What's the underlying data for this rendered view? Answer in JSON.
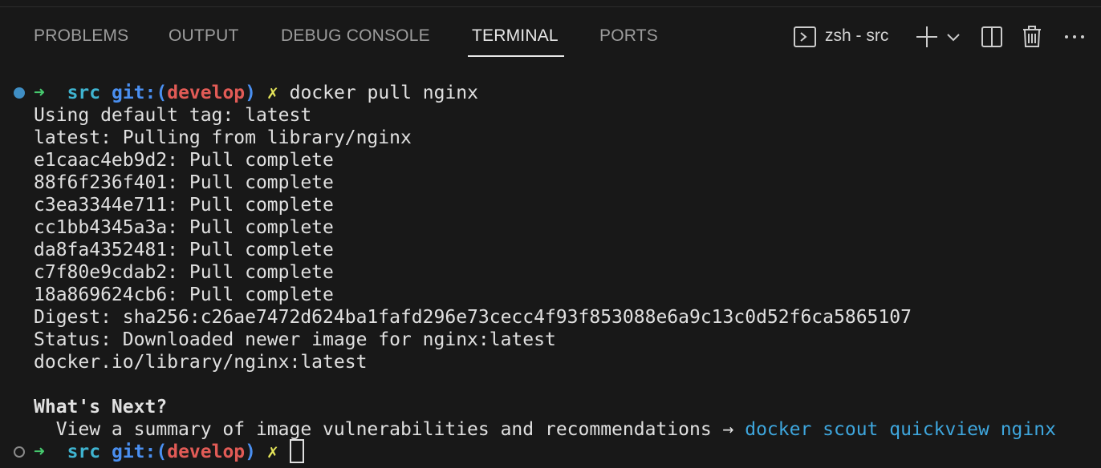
{
  "panel": {
    "tabs": [
      {
        "label": "PROBLEMS"
      },
      {
        "label": "OUTPUT"
      },
      {
        "label": "DEBUG CONSOLE"
      },
      {
        "label": "TERMINAL",
        "active": true
      },
      {
        "label": "PORTS"
      }
    ],
    "shell_label": "zsh - src",
    "icons": [
      "terminal-icon",
      "plus-icon",
      "chevron-down-icon",
      "split-icon",
      "trash-icon",
      "more-icon"
    ]
  },
  "terminal": {
    "prompt": {
      "arrow": "➜",
      "dir": "src",
      "git": "git:(",
      "branch": "develop",
      "git_close": ")",
      "dirty": "✗"
    },
    "command": "docker pull nginx",
    "output": [
      "Using default tag: latest",
      "latest: Pulling from library/nginx",
      "e1caac4eb9d2: Pull complete",
      "88f6f236f401: Pull complete",
      "c3ea3344e711: Pull complete",
      "cc1bb4345a3a: Pull complete",
      "da8fa4352481: Pull complete",
      "c7f80e9cdab2: Pull complete",
      "18a869624cb6: Pull complete",
      "Digest: sha256:c26ae7472d624ba1fafd296e73cecc4f93f853088e6a9c13c0d52f6ca5865107",
      "Status: Downloaded newer image for nginx:latest",
      "docker.io/library/nginx:latest"
    ],
    "whats_next_title": "What's Next?",
    "whats_next_text": "  View a summary of image vulnerabilities and recommendations → ",
    "whats_next_link": "docker scout quickview nginx"
  },
  "colors": {
    "background": "#181818",
    "prompt_arrow": "#46c96e",
    "dir": "#3fb4d0",
    "git": "#4a8ff0",
    "branch": "#e25b56",
    "dirty": "#e5e55a",
    "link": "#3ea6dd",
    "dot_success": "#3f8ec4"
  }
}
